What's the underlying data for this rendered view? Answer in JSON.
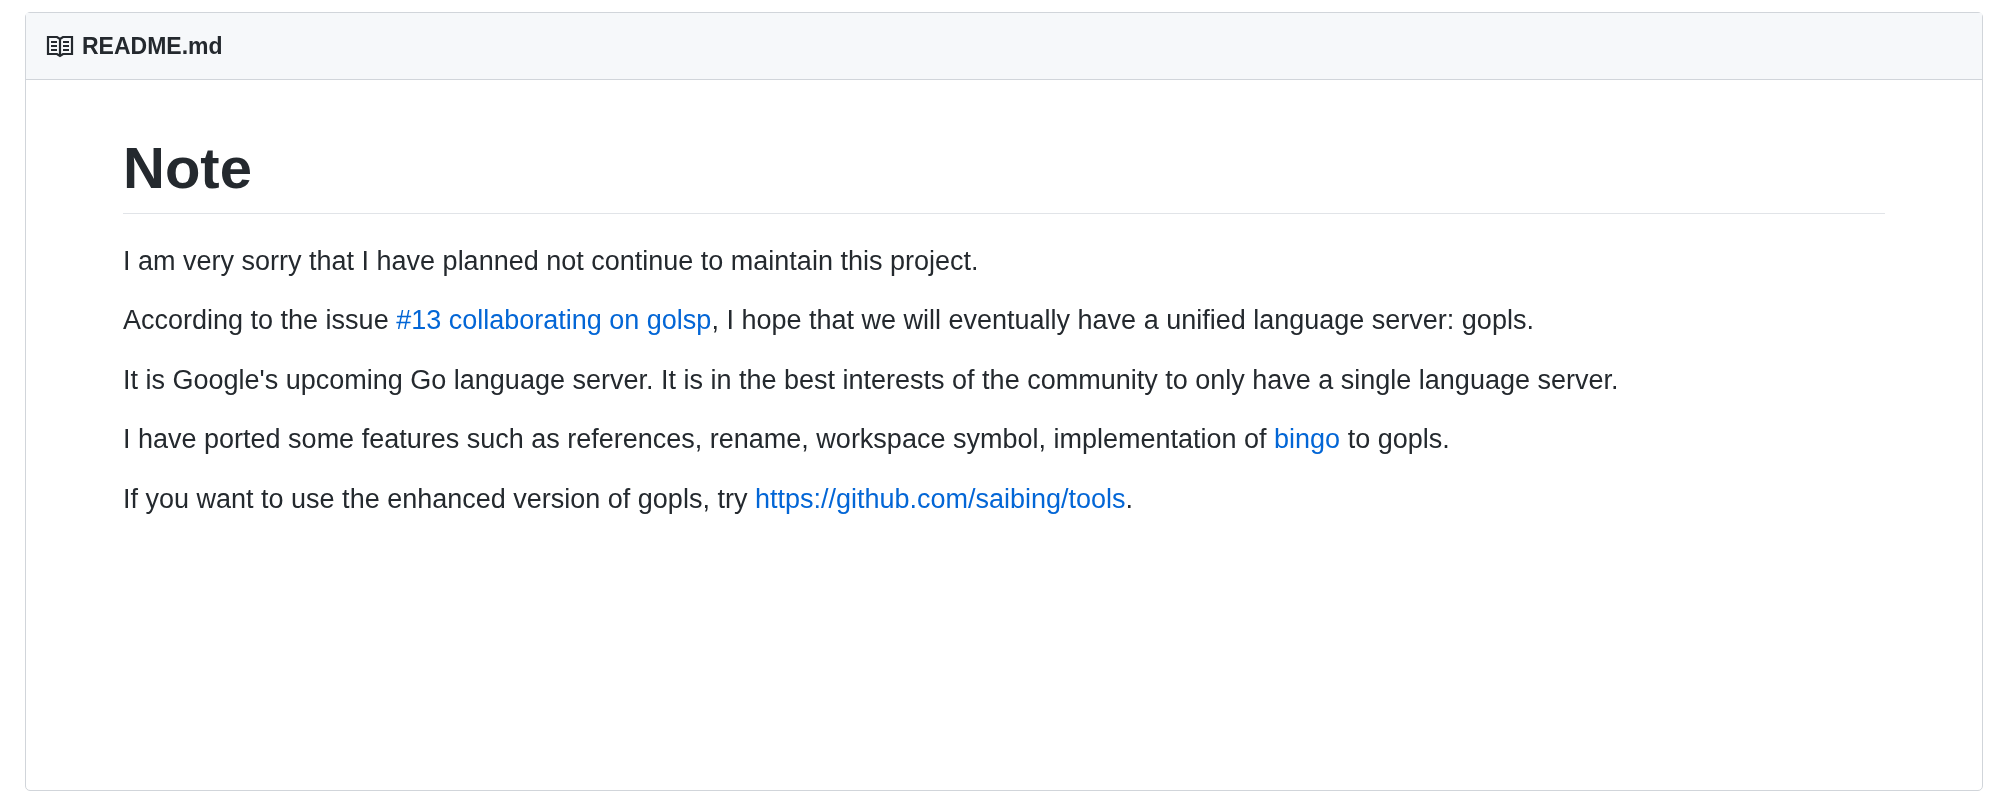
{
  "file_header": {
    "filename": "README.md"
  },
  "readme": {
    "heading": "Note",
    "paragraphs": [
      [
        {
          "kind": "text",
          "text": "I am very sorry that I have planned not continue to maintain this project."
        }
      ],
      [
        {
          "kind": "text",
          "text": "According to the issue "
        },
        {
          "kind": "link",
          "text": "#13 collaborating on golsp"
        },
        {
          "kind": "text",
          "text": ", I hope that we will eventually have a unified language server: gopls."
        }
      ],
      [
        {
          "kind": "text",
          "text": "It is Google's upcoming Go language server. It is in the best interests of the community to only have a single language server."
        }
      ],
      [
        {
          "kind": "text",
          "text": "I have ported some features such as references, rename, workspace symbol, implementation of "
        },
        {
          "kind": "link",
          "text": "bingo"
        },
        {
          "kind": "text",
          "text": " to gopls."
        }
      ],
      [
        {
          "kind": "text",
          "text": "If you want to use the enhanced version of gopls, try "
        },
        {
          "kind": "link",
          "text": "https://github.com/saibing/tools"
        },
        {
          "kind": "text",
          "text": "."
        }
      ]
    ]
  }
}
